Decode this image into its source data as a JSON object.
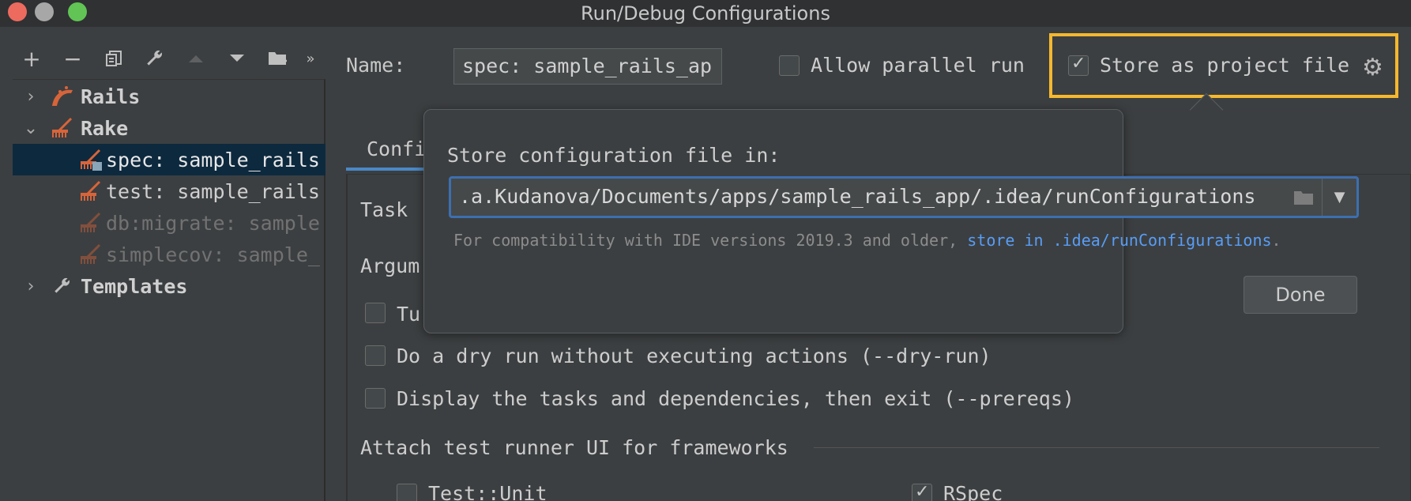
{
  "window": {
    "title": "Run/Debug Configurations"
  },
  "toolbar": {
    "items": [
      "add-icon",
      "remove-icon",
      "copy-icon",
      "wrench-icon",
      "move-up-icon",
      "move-down-icon",
      "new-folder-icon",
      "more-icon"
    ]
  },
  "tree": {
    "items": [
      {
        "label": "Rails",
        "icon": "rails-icon",
        "expanded": false
      },
      {
        "label": "Rake",
        "icon": "rake-icon",
        "expanded": true
      },
      {
        "label": "spec: sample_rails",
        "icon": "rake-config-icon",
        "selected": true
      },
      {
        "label": "test: sample_rails",
        "icon": "rake-config-icon"
      },
      {
        "label": "db:migrate: sample",
        "icon": "rake-config-icon",
        "disabled": true
      },
      {
        "label": "simplecov: sample_",
        "icon": "rake-config-icon",
        "disabled": true
      },
      {
        "label": "Templates",
        "icon": "wrench-icon",
        "expanded": false
      }
    ]
  },
  "header": {
    "name_label": "Name:",
    "name_value": "spec: sample_rails_ap",
    "allow_parallel_label": "Allow parallel run",
    "allow_parallel_checked": false,
    "store_project_label": "Store as project file",
    "store_project_checked": true
  },
  "tabs": {
    "configuration": "Confi"
  },
  "form": {
    "task_label": "Task",
    "arguments_label": "Argum",
    "trace_label": "Tu",
    "dry_run_label": "Do a dry run without executing actions (--dry-run)",
    "prereqs_label": "Display the tasks and dependencies, then exit (--prereqs)",
    "attach_label": "Attach test runner UI for frameworks",
    "test_unit_label": "Test::Unit",
    "rspec_label": "RSpec"
  },
  "popup": {
    "title": "Store configuration file in:",
    "path": ".a.Kudanova/Documents/apps/sample_rails_app/.idea/runConfigurations",
    "hint_prefix": "For compatibility with IDE versions 2019.3 and older,",
    "hint_link": "store in .idea/runConfigurations",
    "hint_suffix": ".",
    "done_label": "Done"
  },
  "colors": {
    "accent": "#4a88c7",
    "highlight": "#f5b82e",
    "link": "#589df6",
    "rails_icon": "#d8643a"
  }
}
